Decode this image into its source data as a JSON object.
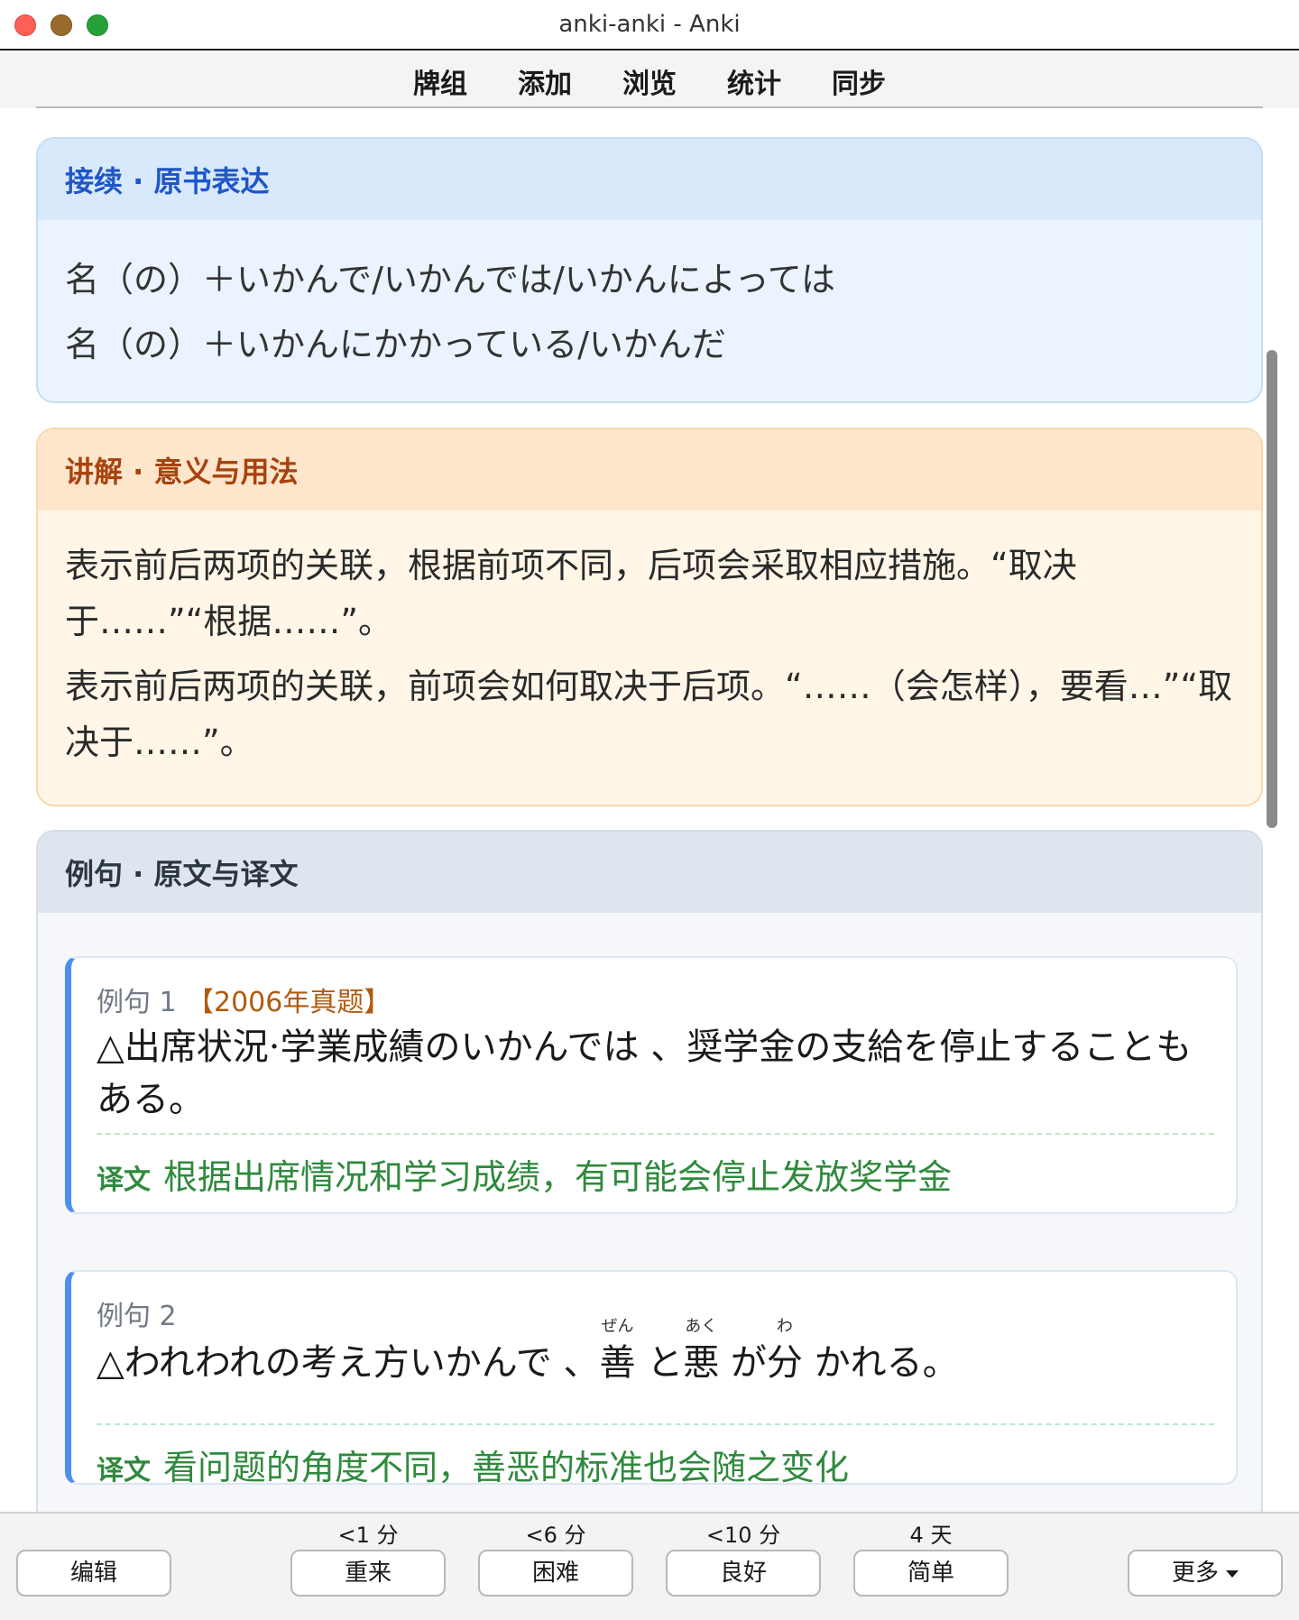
{
  "window": {
    "title": "anki-anki - Anki"
  },
  "toolbar": {
    "items": [
      "牌组",
      "添加",
      "浏览",
      "统计",
      "同步"
    ]
  },
  "sections": {
    "form": {
      "title": "接续 · 原书表达",
      "lines": [
        "名（の）＋いかんで/いかんでは/いかんによっては",
        "名（の）＋いかんにかかっている/いかんだ"
      ]
    },
    "explain": {
      "title": "讲解 · 意义与用法",
      "lines": [
        "表示前后两项的关联，根据前项不同，后项会采取相应措施。“取决于……”“根据……”。",
        "表示前后两项的关联，前项会如何取决于后项。“……（会怎样），要看…”“取决于……”。"
      ]
    },
    "examples": {
      "title": "例句 · 原文与译文",
      "items": [
        {
          "label": "例句 1",
          "tag": "【2006年真题】",
          "sentence": "△出席状況·学業成績のいかんでは 、奨学金の支給を停止することもある。",
          "translation_label": "译文",
          "translation": "根据出席情况和学习成绩，有可能会停止发放奖学金"
        },
        {
          "label": "例句 2",
          "sentence_parts": {
            "pre": "△われわれの考え方いかんで 、",
            "w1": "善",
            "r1": "ぜん",
            "mid1": " と",
            "w2": "悪",
            "r2": "あく",
            "mid2": " が",
            "w3": "分",
            "r3": "わ",
            "post": " かれる。"
          },
          "translation_label": "译文",
          "translation": "看问题的角度不同，善恶的标准也会随之变化"
        }
      ]
    }
  },
  "answer_bar": {
    "edit": "编辑",
    "again": {
      "label": "重来",
      "due": "<1 分"
    },
    "hard": {
      "label": "困难",
      "due": "<6 分"
    },
    "good": {
      "label": "良好",
      "due": "<10 分"
    },
    "easy": {
      "label": "简单",
      "due": "4 天"
    },
    "more": "更多"
  },
  "colors": {
    "form_header": "#d8e9fc",
    "form_title": "#1f56c8",
    "explain_header": "#fde6cc",
    "explain_title": "#a9420e",
    "example_accent": "#4d8ff0",
    "translation": "#2f8a3d",
    "tag": "#b15a0e"
  }
}
